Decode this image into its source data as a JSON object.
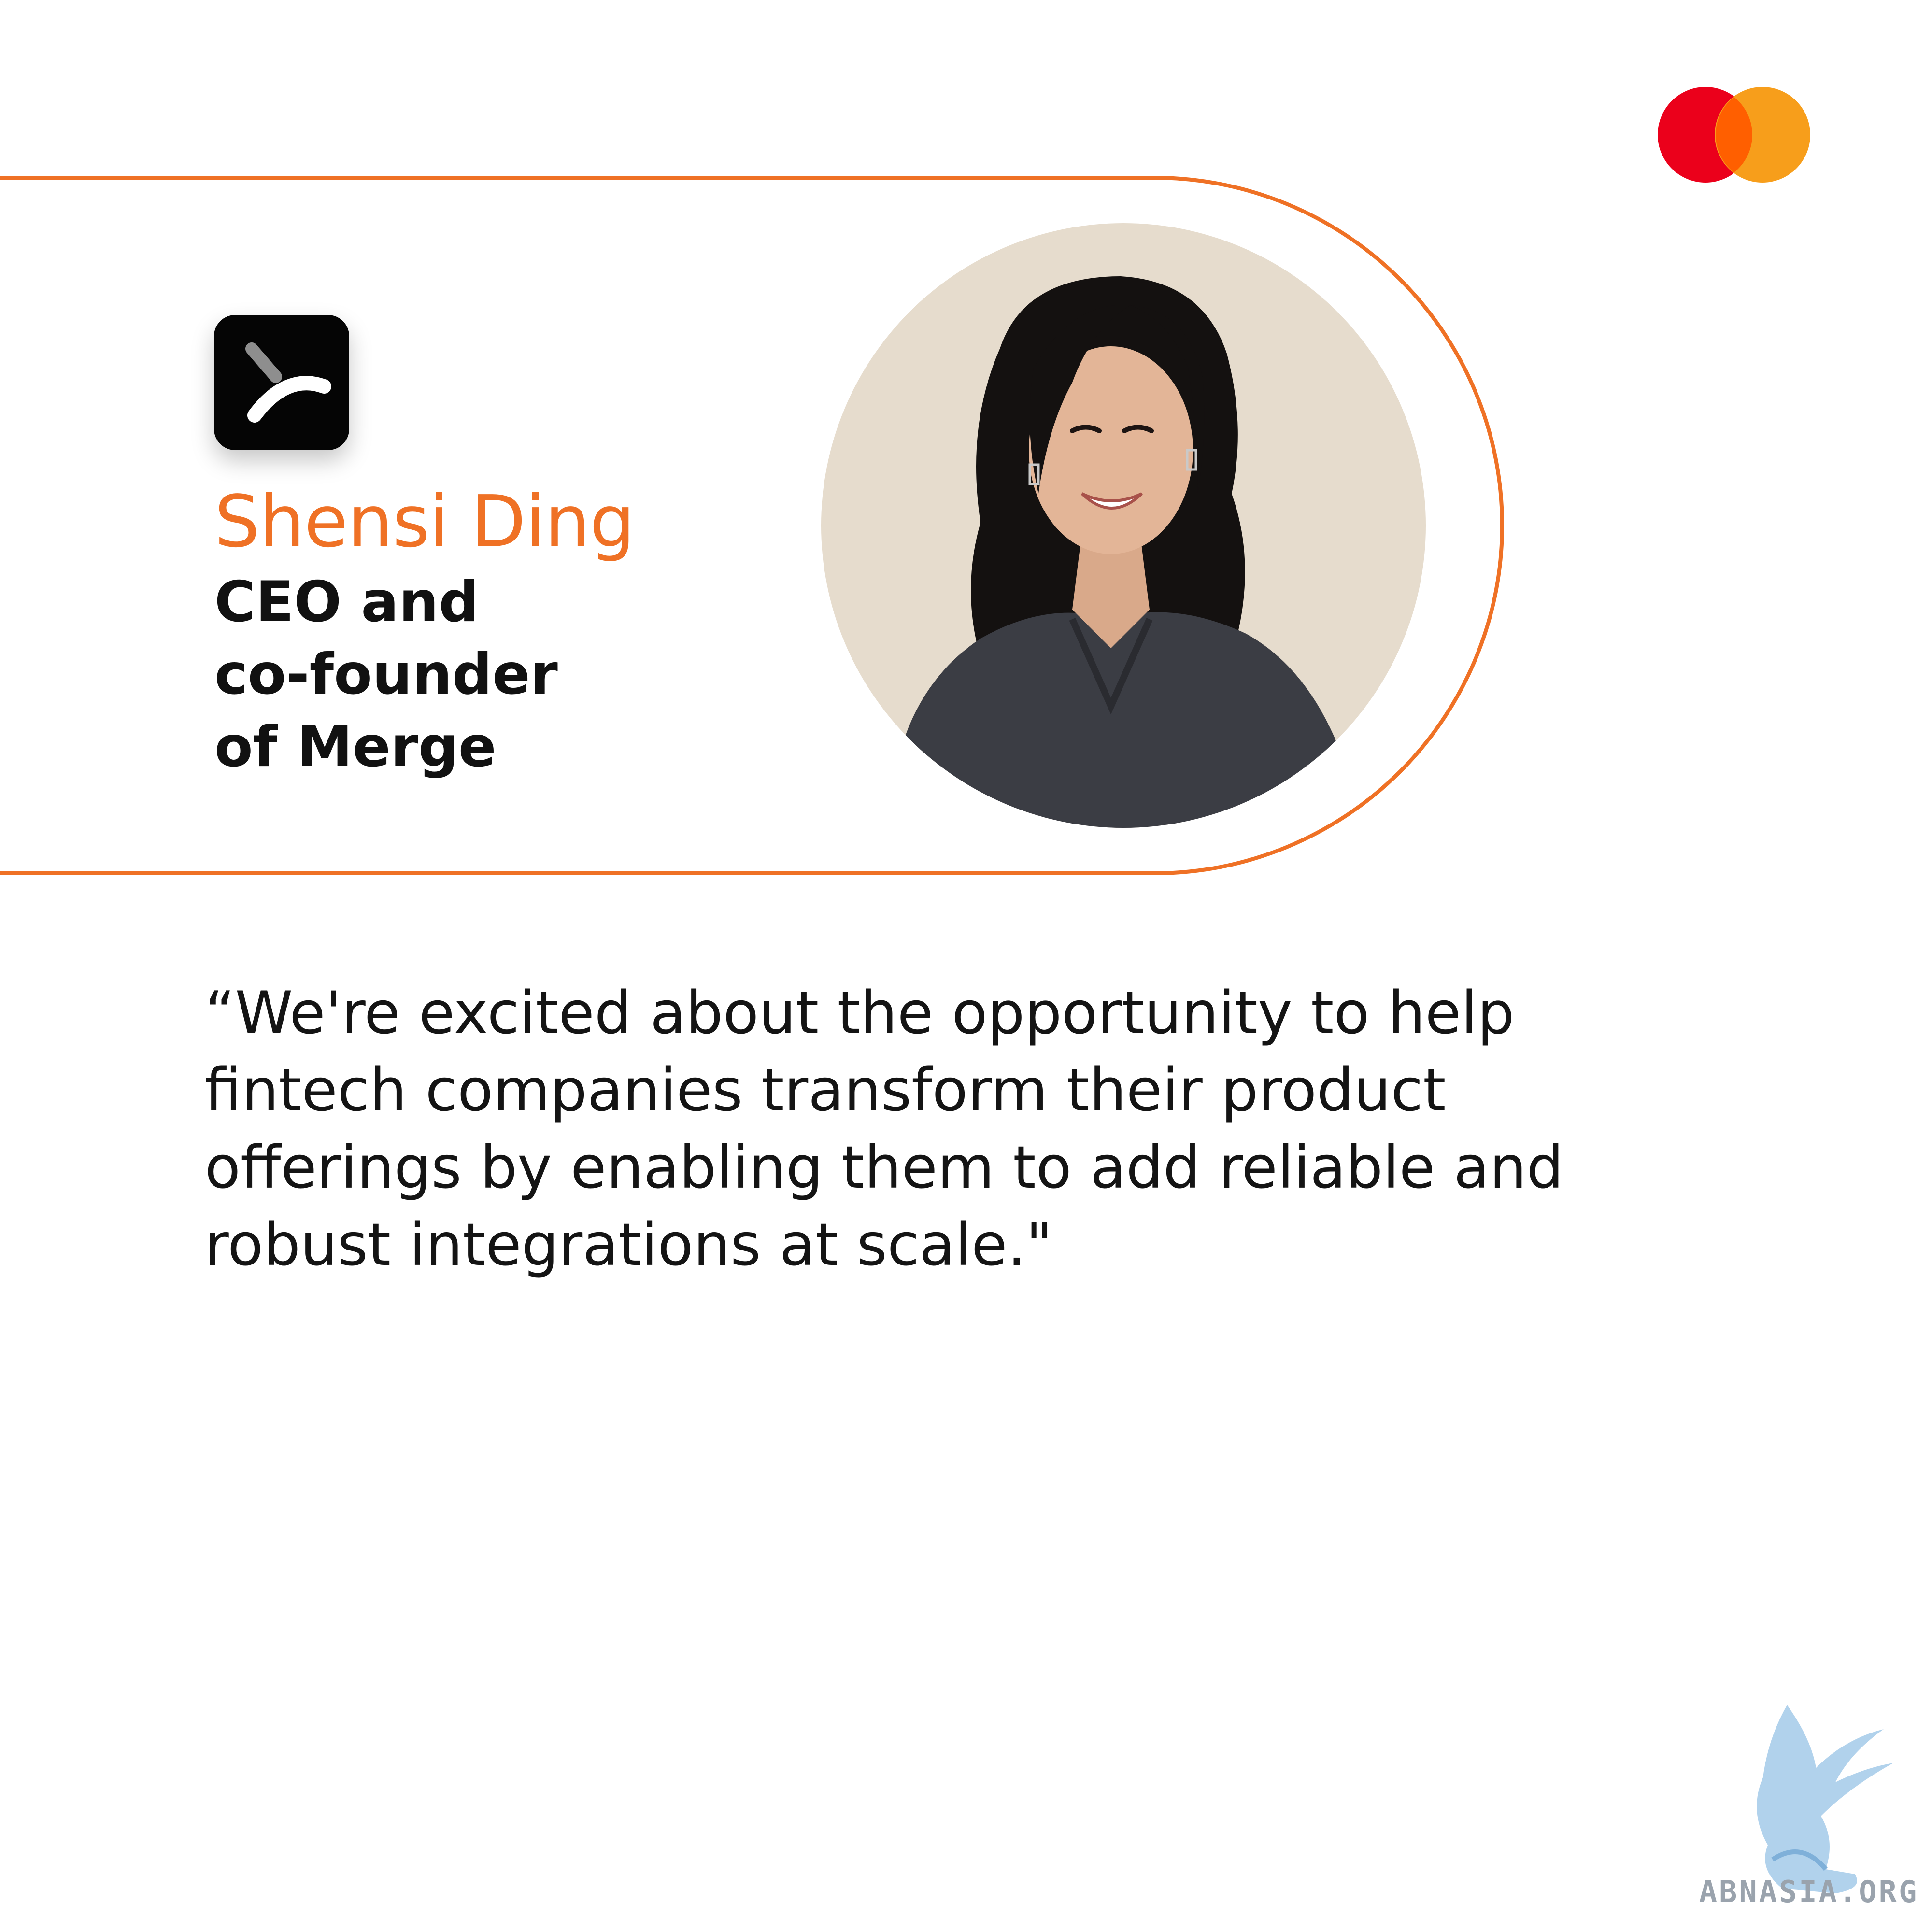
{
  "brand": {
    "logo_icon": "mastercard-logo",
    "colors": {
      "accent_orange": "#ef7125",
      "mc_red": "#eb001b",
      "mc_orange": "#f79e1b",
      "mc_overlap": "#ff5f00"
    }
  },
  "profile": {
    "company_icon": "merge-logo-icon",
    "name": "Shensi Ding",
    "title_lines": [
      "CEO and",
      "co-founder",
      "of Merge"
    ],
    "photo_icon": "portrait-photo"
  },
  "quote": {
    "lines": [
      "“We're excited about the opportunity to help",
      "fintech companies transform their product",
      "offerings by enabling them to add reliable and",
      "robust integrations at scale.\""
    ]
  },
  "watermark": {
    "icon": "griffin-watermark-icon",
    "text": "ABNASIA.ORG"
  }
}
